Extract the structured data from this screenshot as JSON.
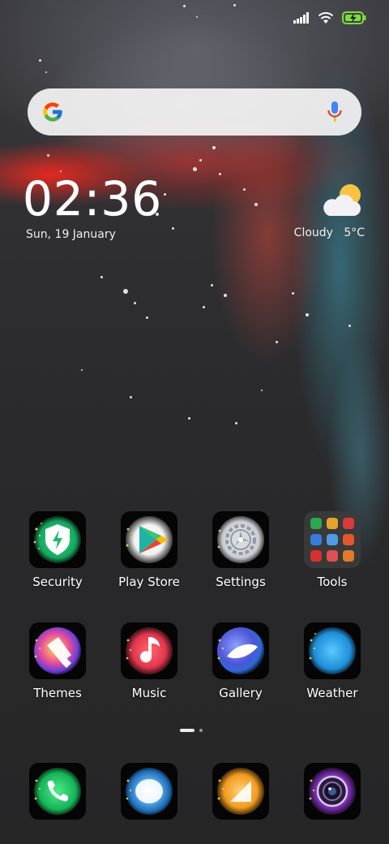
{
  "status_bar": {
    "icons": [
      "signal-icon",
      "wifi-icon",
      "battery-charging-icon"
    ],
    "colors": {
      "battery": "#7ddc3a"
    }
  },
  "search_bar": {
    "icons": [
      "google-logo-icon",
      "microphone-icon"
    ]
  },
  "clock_widget": {
    "time": "02:36",
    "date": "Sun, 19 January"
  },
  "weather_widget": {
    "condition": "Cloudy",
    "temperature": "5°C",
    "icon": "cloud-sun-icon"
  },
  "apps_row1": [
    {
      "label": "Security",
      "icon": "security-shield-icon",
      "color": "#22c77a"
    },
    {
      "label": "Play Store",
      "icon": "play-store-icon",
      "color": "#ffffff"
    },
    {
      "label": "Settings",
      "icon": "settings-gear-icon",
      "color": "#cfd6df"
    },
    {
      "label": "Tools",
      "icon": "tools-folder-icon",
      "color": "#333333"
    }
  ],
  "apps_row2": [
    {
      "label": "Themes",
      "icon": "themes-brush-icon",
      "color": "#d23ad8"
    },
    {
      "label": "Music",
      "icon": "music-note-icon",
      "color": "#e43a52"
    },
    {
      "label": "Gallery",
      "icon": "gallery-icon",
      "color": "#5a5ce0"
    },
    {
      "label": "Weather",
      "icon": "weather-icon",
      "color": "#2aa5e6"
    }
  ],
  "page_indicator": {
    "pages": 2,
    "current": 1
  },
  "dock": [
    {
      "icon": "phone-icon",
      "color": "#1fc763"
    },
    {
      "icon": "messages-icon",
      "color": "#2c8fd6"
    },
    {
      "icon": "browser-icon",
      "color": "#f29b1f"
    },
    {
      "icon": "camera-icon",
      "color": "#8a2fb8"
    }
  ]
}
